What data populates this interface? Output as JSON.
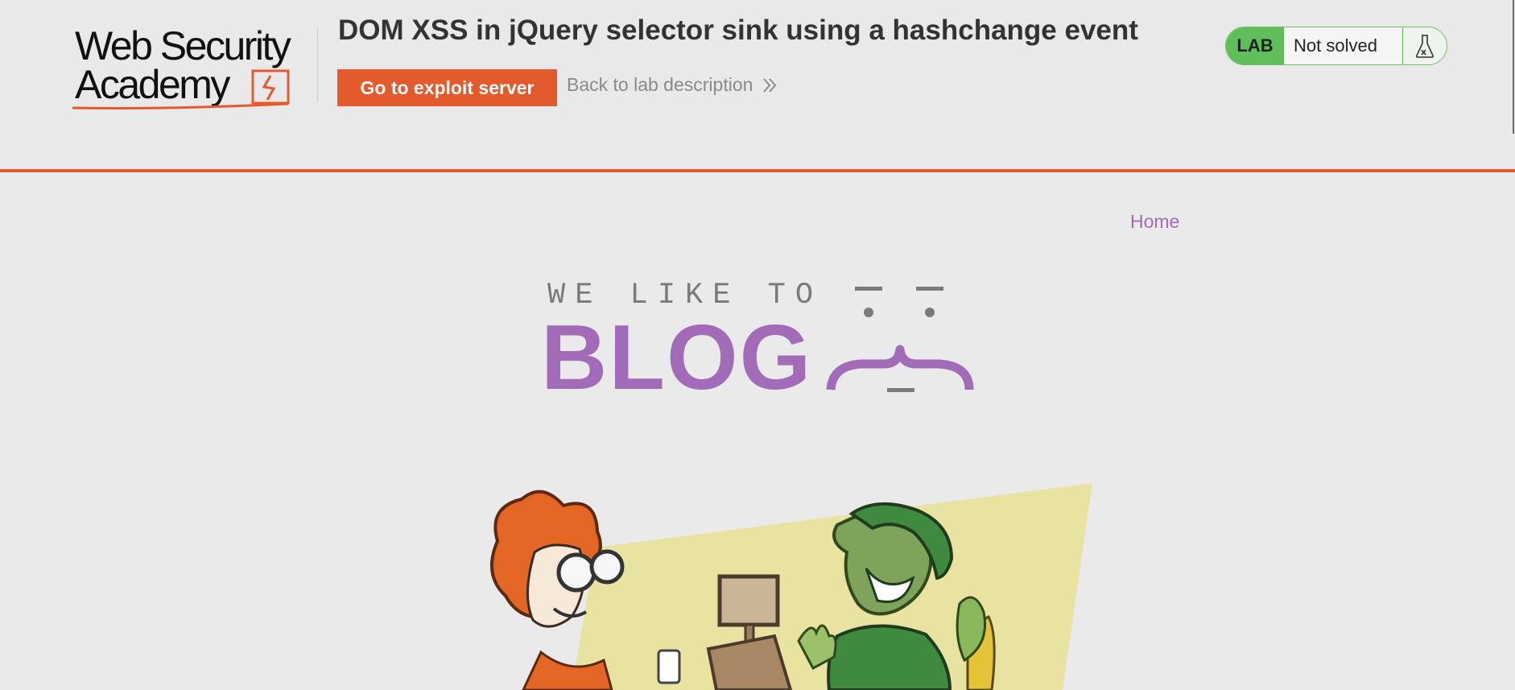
{
  "header": {
    "logo_line1": "Web Security",
    "logo_line2": "Academy",
    "lab_title": "DOM XSS in jQuery selector sink using a hashchange event",
    "exploit_button": "Go to exploit server",
    "back_link": "Back to lab description"
  },
  "status": {
    "badge": "LAB",
    "text": "Not solved"
  },
  "nav": {
    "home": "Home"
  },
  "blog_header": {
    "tagline": "WE LIKE TO",
    "word": "BLOG"
  },
  "colors": {
    "accent_orange": "#e35a2c",
    "brand_purple": "#a16bb7",
    "status_green": "#5fbe5a",
    "background": "#eaeaea"
  },
  "icons": [
    "web-security-academy-logo",
    "chevron-double-right-icon",
    "flask-icon",
    "blog-face-icon"
  ]
}
